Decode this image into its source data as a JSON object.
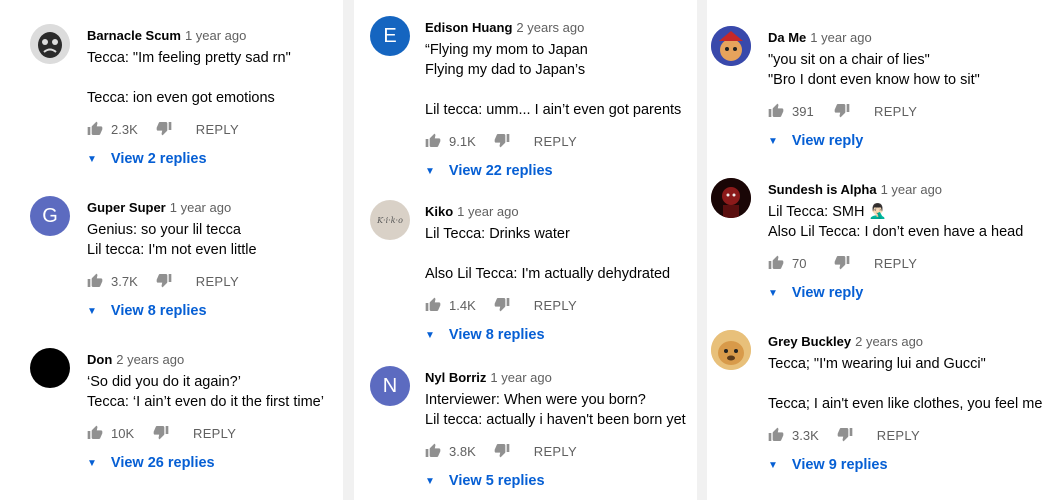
{
  "columns": [
    {
      "comments": [
        {
          "author": "Barnacle Scum",
          "time": "1 year ago",
          "lines": [
            "Tecca: \"Im feeling pretty sad rn\"",
            "",
            "Tecca: ion even got emotions"
          ],
          "likes": "2.3K",
          "reply": "REPLY",
          "replies": "View 2 replies",
          "avatar": {
            "type": "image",
            "icon": "sad-face-meme-icon",
            "bg": "#dedede"
          }
        },
        {
          "author": "Guper Super",
          "time": "1 year ago",
          "lines": [
            "Genius: so your lil tecca",
            "Lil tecca: I'm not even little"
          ],
          "likes": "3.7K",
          "reply": "REPLY",
          "replies": "View 8 replies",
          "avatar": {
            "type": "letter",
            "letter": "G",
            "bg": "#5c6bc0"
          }
        },
        {
          "author": "Don",
          "time": "2 years ago",
          "lines": [
            "‘So did you do it again?’",
            "Tecca: ‘I ain’t even do it the first time’"
          ],
          "likes": "10K",
          "reply": "REPLY",
          "replies": "View 26 replies",
          "avatar": {
            "type": "solid",
            "bg": "#000000"
          }
        }
      ]
    },
    {
      "comments": [
        {
          "author": "Edison Huang",
          "time": "2 years ago",
          "lines": [
            "“Flying my mom to Japan",
            "Flying my dad to Japan’s",
            "",
            "Lil tecca: umm... I ain’t even got parents"
          ],
          "likes": "9.1K",
          "reply": "REPLY",
          "replies": "View 22 replies",
          "avatar": {
            "type": "letter",
            "letter": "E",
            "bg": "#1565c0"
          }
        },
        {
          "author": "Kiko",
          "time": "1 year ago",
          "lines": [
            "Lil Tecca: Drinks water",
            "",
            "Also Lil Tecca: I'm actually dehydrated"
          ],
          "likes": "1.4K",
          "reply": "REPLY",
          "replies": "View 8 replies",
          "avatar": {
            "type": "image",
            "icon": "kiko-text-avatar-icon",
            "text": "K·i·k·o",
            "bg": "#d9d1c7"
          }
        },
        {
          "author": "Nyl Borriz",
          "time": "1 year ago",
          "lines": [
            "Interviewer: When were you born?",
            "Lil tecca: actually i haven't been born yet"
          ],
          "likes": "3.8K",
          "reply": "REPLY",
          "replies": "View 5 replies",
          "avatar": {
            "type": "letter",
            "letter": "N",
            "bg": "#5c6bc0"
          }
        }
      ]
    },
    {
      "comments": [
        {
          "author": "Da Me",
          "time": "1 year ago",
          "lines": [
            "\"you sit on a chair of lies\"",
            "\"Bro I dont even know how to sit\""
          ],
          "likes": "391",
          "reply": "REPLY",
          "replies": "View reply",
          "avatar": {
            "type": "image",
            "icon": "cartoon-character-icon",
            "bg": "#3f51b5"
          }
        },
        {
          "author": "Sundesh is Alpha",
          "time": "1 year ago",
          "lines": [
            "Lil Tecca: SMH 🤦🏻‍♂️",
            "Also Lil Tecca: I don’t even have a head"
          ],
          "likes": "70",
          "reply": "REPLY",
          "replies": "View reply",
          "avatar": {
            "type": "image",
            "icon": "dark-red-figure-icon",
            "bg": "#2a0a0a"
          }
        },
        {
          "author": "Grey Buckley",
          "time": "2 years ago",
          "lines": [
            "Tecca; \"I'm wearing lui and Gucci\"",
            "",
            "Tecca; I ain't even like clothes, you feel me"
          ],
          "likes": "3.3K",
          "reply": "REPLY",
          "replies": "View 9 replies",
          "avatar": {
            "type": "image",
            "icon": "doge-meme-icon",
            "bg": "#e0b36a"
          }
        }
      ]
    }
  ],
  "colors": {
    "link": "#065fd4",
    "meta": "#606060",
    "text": "#030303"
  }
}
